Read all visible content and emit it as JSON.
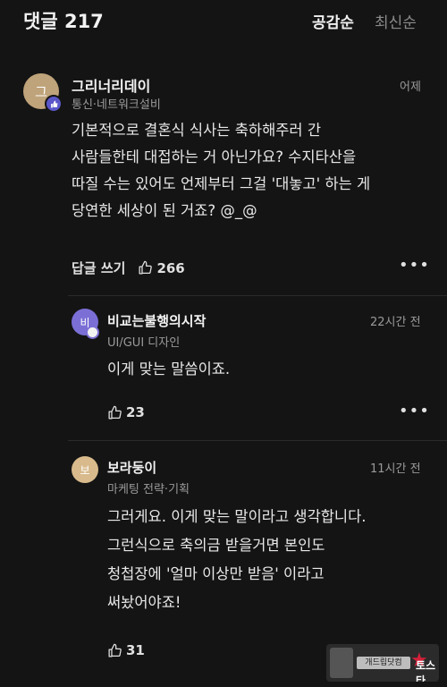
{
  "header": {
    "title": "댓글 217",
    "sort_popular": "공감순",
    "sort_latest": "최신순"
  },
  "comments": [
    {
      "avatar_char": "그",
      "avatar_color": "#bfa37a",
      "name": "그리너리데이",
      "subtitle": "통신·네트워크설비",
      "time": "어제",
      "lines": [
        "기본적으로 결혼식 식사는 축하해주러 간",
        "사람들한테 대접하는 거 아닌가요? 수지타산을",
        "따질 수는 있어도 언제부터 그걸 '대놓고' 하는 게",
        "당연한 세상이 된 거죠? @_@"
      ],
      "reply_label": "답글 쓰기",
      "likes": "266"
    }
  ],
  "replies": [
    {
      "avatar_char": "비",
      "avatar_color": "#7b6fd6",
      "name": "비교는불행의시작",
      "subtitle": "UI/GUI 디자인",
      "time": "22시간 전",
      "lines": [
        "이게 맞는 말씀이죠."
      ],
      "likes": "23"
    },
    {
      "avatar_char": "보",
      "avatar_color": "#d8ba8c",
      "name": "보라둥이",
      "subtitle": "마케팅 전략·기획",
      "time": "11시간 전",
      "lines": [
        "그러게요. 이게 맞는 말이라고 생각합니다.",
        "그런식으로 축의금 받을거면 본인도",
        "청첩장에 '얼마 이상만 받음' 이라고",
        "써놨어야죠!"
      ],
      "likes": "31"
    }
  ],
  "watermark": {
    "label": "개드립닷컴",
    "word": "토스타"
  },
  "icons": {
    "like": "thumbs-up-icon",
    "more": "more-horizontal-icon",
    "badge": "thumbs-up-badge-icon"
  }
}
